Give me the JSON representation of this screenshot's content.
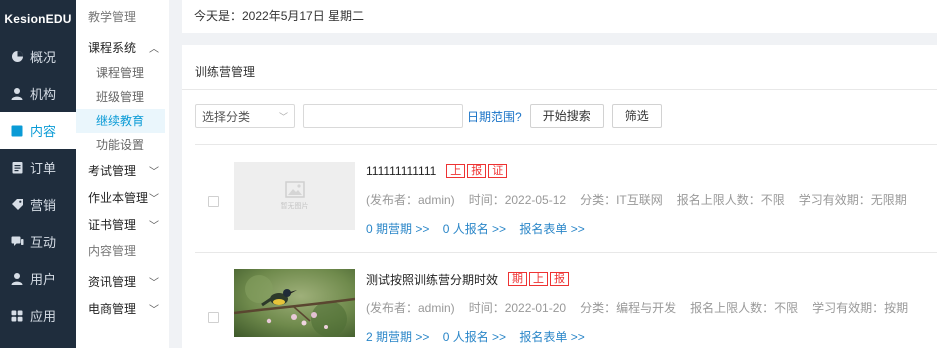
{
  "brand": "KesionEDU",
  "nav": [
    {
      "label": "概况",
      "icon": "dashboard-icon"
    },
    {
      "label": "机构",
      "icon": "user-icon"
    },
    {
      "label": "内容",
      "icon": "content-icon"
    },
    {
      "label": "订单",
      "icon": "order-icon"
    },
    {
      "label": "营销",
      "icon": "tag-icon"
    },
    {
      "label": "互动",
      "icon": "chat-icon"
    },
    {
      "label": "用户",
      "icon": "user-icon"
    },
    {
      "label": "应用",
      "icon": "apps-icon"
    }
  ],
  "submenu": {
    "section1": "教学管理",
    "course_group": "课程系统",
    "course_items": [
      "课程管理",
      "班级管理",
      "继续教育",
      "功能设置"
    ],
    "groups_a": [
      "考试管理",
      "作业本管理",
      "证书管理"
    ],
    "section2": "内容管理",
    "groups_b": [
      "资讯管理",
      "电商管理"
    ]
  },
  "topbar": {
    "date_text": "今天是：2022年5月17日 星期二"
  },
  "panel": {
    "title": "训练营管理"
  },
  "filter": {
    "category_placeholder": "选择分类",
    "date_range_link": "日期范围?",
    "search_button": "开始搜索",
    "filter_button": "筛选"
  },
  "rows": [
    {
      "title": "111111111111",
      "tags": [
        "上",
        "报",
        "证"
      ],
      "thumb_placeholder": "暂无图片",
      "publisher": "(发布者：admin)",
      "time": "时间：2022-05-12",
      "category": "分类：IT互联网",
      "limit": "报名上限人数：不限",
      "validity": "学习有效期：无限期",
      "periods": "0 期营期 >>",
      "signups": "0 人报名 >>",
      "form": "报名表单 >>"
    },
    {
      "title": "测试按照训练营分期时效",
      "tags": [
        "期",
        "上",
        "报"
      ],
      "publisher": "(发布者：admin)",
      "time": "时间：2022-01-20",
      "category": "分类：编程与开发",
      "limit": "报名上限人数：不限",
      "validity": "学习有效期：按期",
      "periods": "2 期营期 >>",
      "signups": "0 人报名 >>",
      "form": "报名表单 >>"
    }
  ],
  "colors": {
    "sidebar": "#1f2d3d",
    "accent": "#0a9bd6",
    "tag": "#e33333",
    "link": "#2a86c8"
  }
}
